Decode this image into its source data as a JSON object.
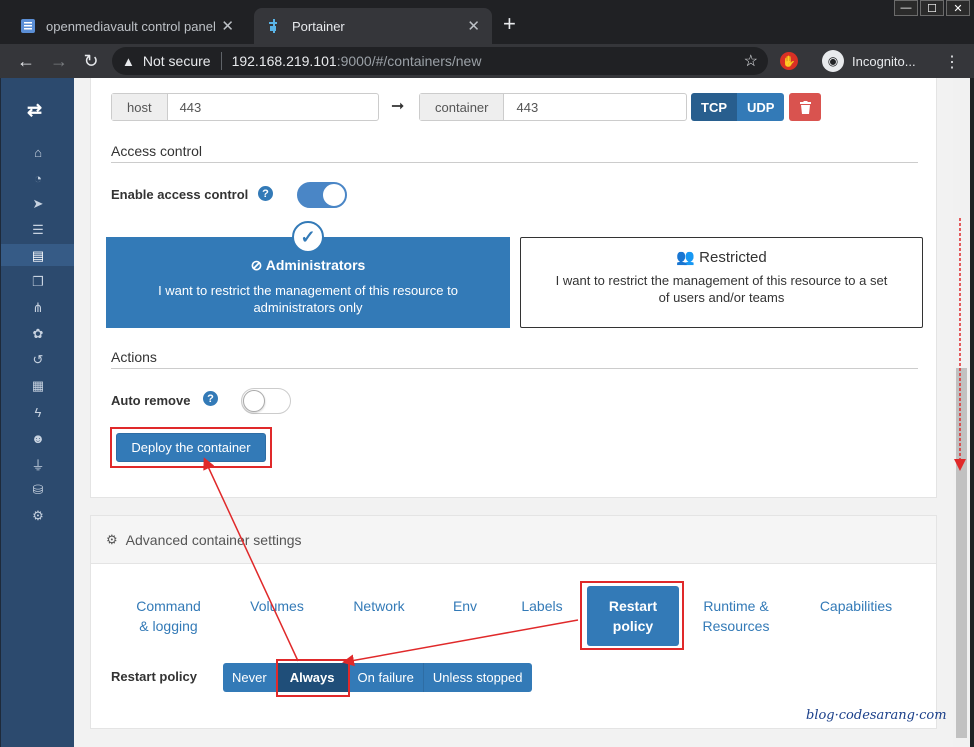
{
  "browser": {
    "tabs": [
      {
        "title": "openmediavault control panel - I",
        "active": false
      },
      {
        "title": "Portainer",
        "active": true
      }
    ],
    "not_secure": "Not secure",
    "url_host": "192.168.219.101",
    "url_path": ":9000/#/containers/new",
    "profile_label": "Incognito..."
  },
  "port_mapping": {
    "host_label": "host",
    "host_value": "443",
    "container_label": "container",
    "container_value": "443",
    "protocols": [
      "TCP",
      "UDP"
    ],
    "selected_protocol": "TCP"
  },
  "access_control": {
    "section_title": "Access control",
    "enable_label": "Enable access control",
    "enabled": true,
    "options": [
      {
        "title": "Administrators",
        "description": "I want to restrict the management of this resource to administrators only",
        "selected": true
      },
      {
        "title": "Restricted",
        "description": "I want to restrict the management of this resource to a set of users and/or teams",
        "selected": false
      }
    ]
  },
  "actions": {
    "section_title": "Actions",
    "auto_remove_label": "Auto remove",
    "auto_remove": false,
    "deploy_label": "Deploy the container"
  },
  "advanced": {
    "header": "Advanced container settings",
    "tabs": [
      {
        "label": "Command\n& logging"
      },
      {
        "label": "Volumes"
      },
      {
        "label": "Network"
      },
      {
        "label": "Env"
      },
      {
        "label": "Labels"
      },
      {
        "label": "Restart\npolicy",
        "active": true
      },
      {
        "label": "Runtime &\nResources"
      },
      {
        "label": "Capabilities"
      }
    ],
    "restart_policy_label": "Restart policy",
    "restart_options": [
      "Never",
      "Always",
      "On failure",
      "Unless stopped"
    ],
    "restart_selected": "Always"
  },
  "watermark": "blog·codesarang·com",
  "colors": {
    "primary": "#337ab7",
    "danger": "#d9534f",
    "sidebar": "#2c4a6e",
    "annotation": "#e0292a"
  },
  "sidebar_icons": [
    "portainer-logo-icon",
    "home-icon",
    "dashboard-icon",
    "app-templates-icon",
    "stacks-icon",
    "containers-icon",
    "images-icon",
    "networks-icon",
    "volumes-icon",
    "events-icon",
    "host-icon",
    "users-icon",
    "endpoints-icon",
    "registries-icon",
    "settings-icon"
  ]
}
